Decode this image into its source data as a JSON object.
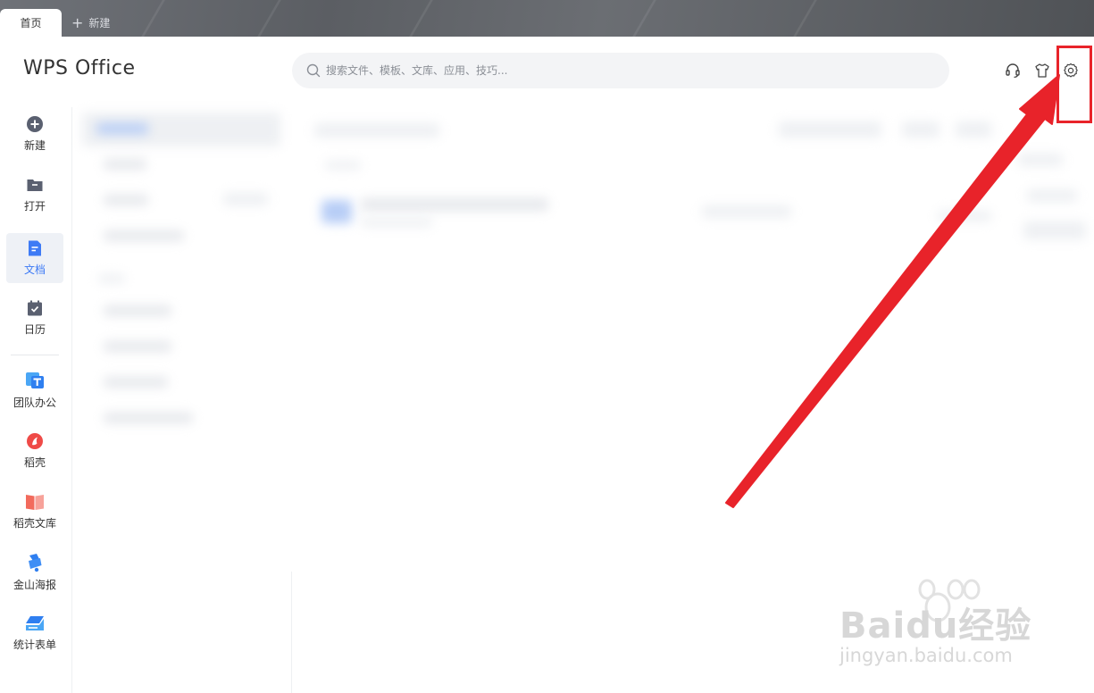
{
  "tabs": {
    "home": "首页",
    "new": "新建"
  },
  "header": {
    "logo": "WPS Office",
    "search_placeholder": "搜索文件、模板、文库、应用、技巧...",
    "icons": [
      "headset-icon",
      "skin-icon",
      "settings-icon"
    ]
  },
  "nav": {
    "items": [
      {
        "label": "新建",
        "icon": "plus-circle-icon"
      },
      {
        "label": "打开",
        "icon": "folder-icon"
      },
      {
        "label": "文档",
        "icon": "document-icon",
        "active": true
      },
      {
        "label": "日历",
        "icon": "calendar-icon"
      },
      {
        "label": "团队办公",
        "icon": "team-icon"
      },
      {
        "label": "稻壳",
        "icon": "docer-icon"
      },
      {
        "label": "稻壳文库",
        "icon": "library-icon"
      },
      {
        "label": "金山海报",
        "icon": "poster-icon"
      },
      {
        "label": "统计表单",
        "icon": "form-icon"
      }
    ]
  },
  "colors": {
    "accent": "#3e7bf5",
    "annotation": "#e8232a"
  },
  "watermark": {
    "brand": "Baidu经验",
    "url": "jingyan.baidu.com"
  }
}
